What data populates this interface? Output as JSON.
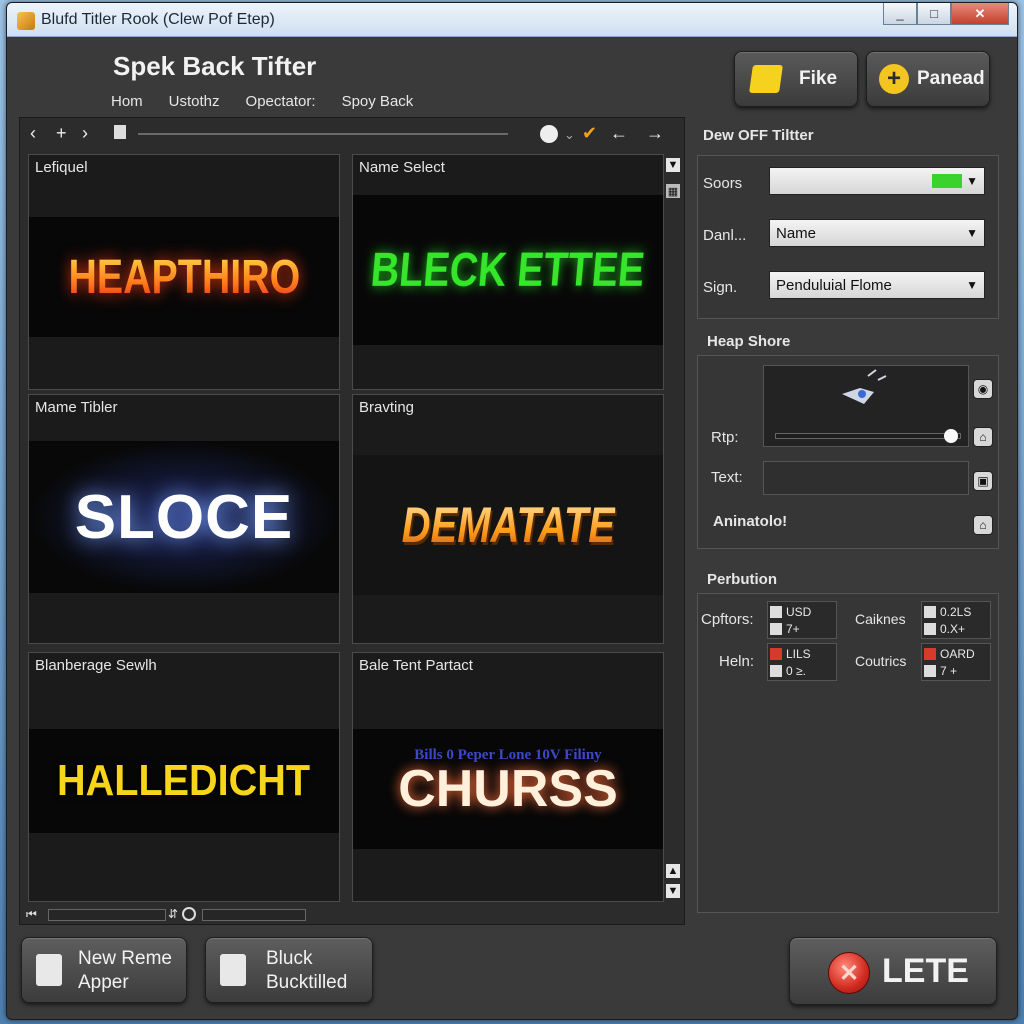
{
  "window": {
    "title": "Blufd Titler Rook (Clew Pof Etep)",
    "minimize": "_",
    "maximize": "□",
    "close": "✕"
  },
  "header": {
    "app_title": "Spek Back Tifter",
    "menu": [
      "Hom",
      "Ustothz",
      "Opectator:",
      "Spoy Back"
    ],
    "fike_label": "Fike",
    "panead_label": "Panead"
  },
  "gallery": {
    "toolbar_icons": [
      "chevron-left-icon",
      "plus-icon",
      "chevron-right-icon",
      "stop-square-icon",
      "record-icon",
      "check-icon",
      "back-arrow-icon",
      "forward-arrow-icon"
    ],
    "tiles": [
      {
        "label": "Lefiquel",
        "art": "HEAPTHIRO"
      },
      {
        "label": "Name Select",
        "art": "BLECK ETTEE"
      },
      {
        "label": "Mame Tibler",
        "art": "SLOCE"
      },
      {
        "label": "Bravting",
        "art": "DEMATATE"
      },
      {
        "label": "Blanberage Sewlh",
        "art": "HALLEDICHT"
      },
      {
        "label": "Bale Tent Partact",
        "art": "CHURSS",
        "subart": "Bills 0 Peper Lone 10V Filiny"
      }
    ]
  },
  "panel": {
    "filter_title": "Dew OFF Tiltter",
    "filter_rows": [
      {
        "label": "Soors",
        "value": ""
      },
      {
        "label": "Danl...",
        "value": "Name"
      },
      {
        "label": "Sign.",
        "value": "Penduluial Flome"
      }
    ],
    "heap_title": "Heap Shore",
    "rtp_label": "Rtp:",
    "text_label": "Text:",
    "animation_label": "Aninatolo!",
    "slider_value": 0.95,
    "perbution_title": "Perbution",
    "perbution_rows": [
      {
        "label": "Cpftors:",
        "box_lines": [
          "USD",
          "7+"
        ],
        "label2": "Caiknes",
        "box2_lines": [
          "0.2LS",
          "0.X+"
        ]
      },
      {
        "label": "Heln:",
        "box_lines": [
          "LILS",
          "0 ≥."
        ],
        "label2": "Coutrics",
        "box2_lines": [
          "OARD",
          "7 +"
        ]
      }
    ]
  },
  "footer": {
    "new_btn": [
      "New Reme",
      "Apper"
    ],
    "bluck_btn": [
      "Bluck",
      "Bucktilled"
    ],
    "lete_label": "LETE"
  },
  "colors": {
    "accent_green": "#3ad22c",
    "accent_yellow": "#f2c521",
    "danger": "#d12a1f"
  }
}
